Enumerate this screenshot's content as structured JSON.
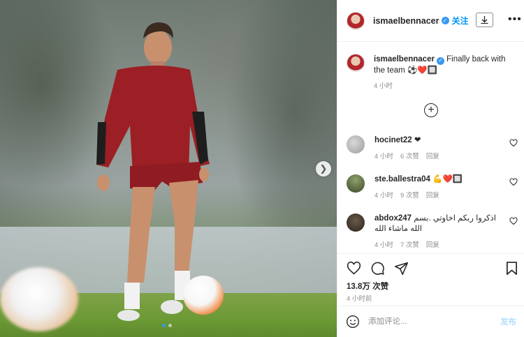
{
  "post": {
    "image_alt": "",
    "carousel": {
      "current": 1,
      "total": 2
    }
  },
  "header": {
    "username": "ismaelbennacer",
    "follow_label": "关注",
    "more_label": "•••"
  },
  "caption": {
    "username": "ismaelbennacer",
    "text": "Finally back with the team ⚽❤️🔲",
    "time": "4 小时"
  },
  "comments": [
    {
      "username": "hocinet22",
      "text": "❤",
      "time": "4 小时",
      "likes": "6 次赞",
      "reply": "回复"
    },
    {
      "username": "ste.ballestra04",
      "text": "💪❤️🔲",
      "time": "4 小时",
      "likes": "9 次赞",
      "reply": "回复"
    },
    {
      "username": "abdox247",
      "text": "اذكروا ربكم اخاوتي .بسم الله ماشاء الله",
      "time": "4 小时",
      "likes": "7 次赞",
      "reply": "回复"
    }
  ],
  "stats": {
    "likes": "13.8万 次赞",
    "posted": "4 小时前"
  },
  "comment_box": {
    "placeholder": "添加评论...",
    "post_label": "发布"
  },
  "colors": {
    "accent": "#0095f6",
    "verified": "#3897f0",
    "muted": "#8e8e8e",
    "jersey": "#9b1f24"
  }
}
